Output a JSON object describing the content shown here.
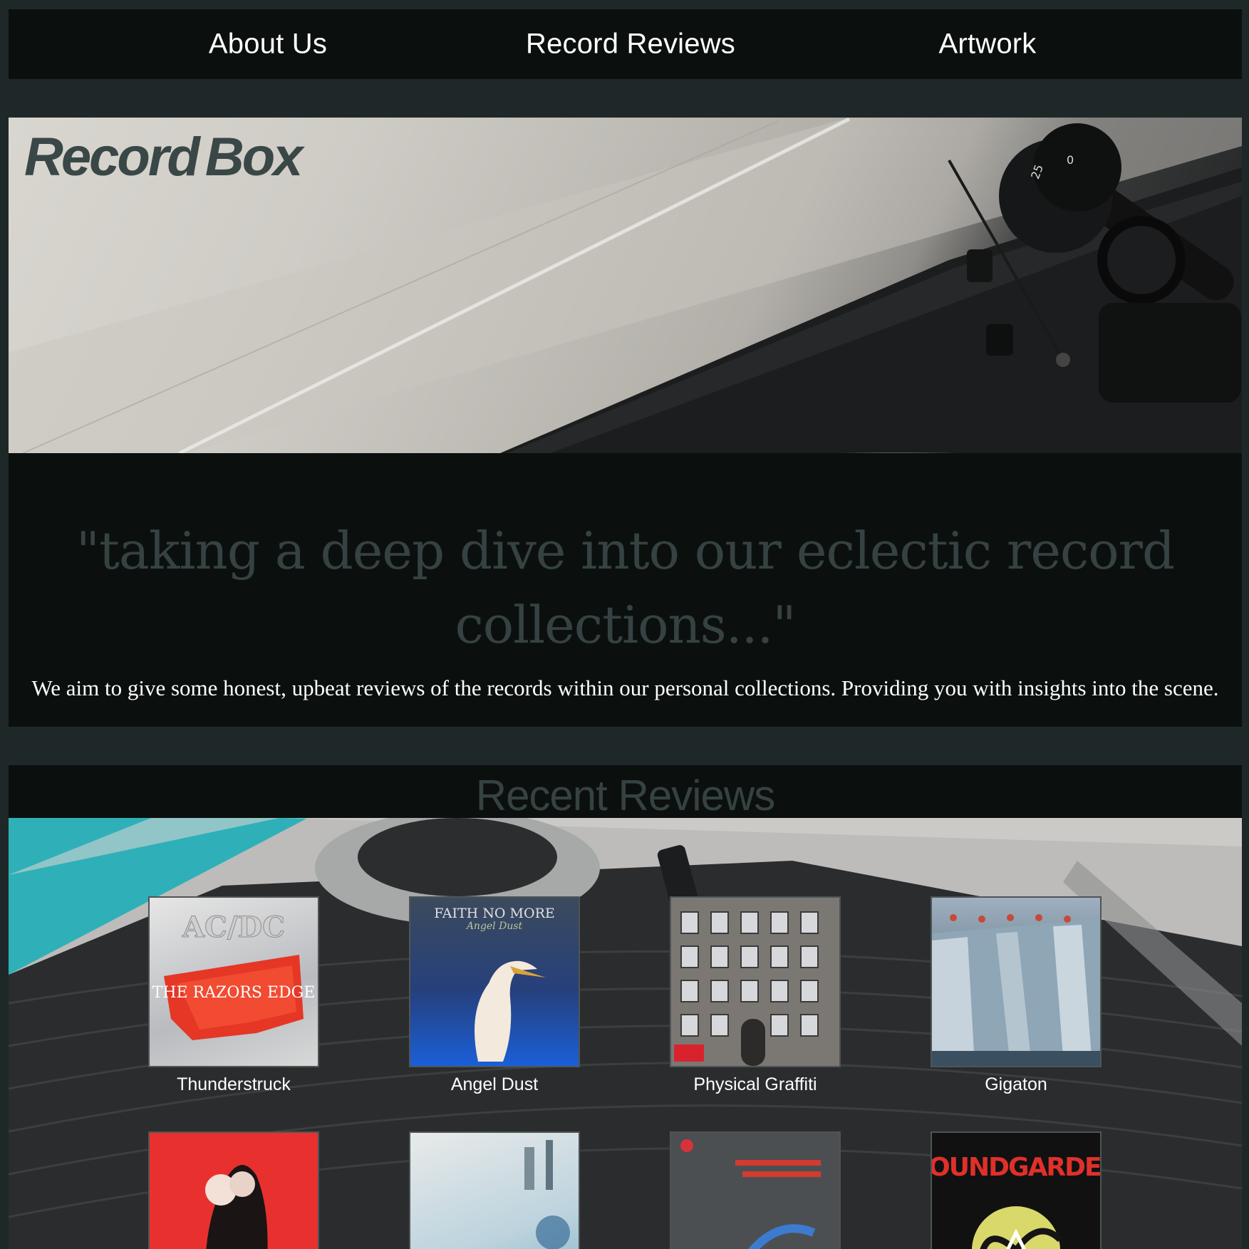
{
  "nav": {
    "about": "About Us",
    "reviews": "Record Reviews",
    "artwork": "Artwork"
  },
  "hero": {
    "logo_part1": "Record",
    "logo_part2": "Box"
  },
  "intro": {
    "tagline": "\"taking a deep dive into our eclectic record collections...\"",
    "mission": "We aim to give some honest, upbeat reviews of the records within our personal collections. Providing you with insights into the scene."
  },
  "recent": {
    "title": "Recent Reviews",
    "albums": [
      {
        "title": "Thunderstruck",
        "cover_text": "AC/DC",
        "cover_sub": "THE RAZORS EDGE"
      },
      {
        "title": "Angel Dust",
        "cover_text": "FAITH NO MORE",
        "cover_sub": "Angel Dust"
      },
      {
        "title": "Physical Graffiti"
      },
      {
        "title": "Gigaton"
      },
      {
        "title": ""
      },
      {
        "title": ""
      },
      {
        "title": ""
      },
      {
        "title": "",
        "cover_text": "SOUNDGARDEN"
      }
    ]
  },
  "colors": {
    "page_bg": "#1f2829",
    "panel_bg": "#0b100f",
    "muted_heading": "#364242",
    "text": "#ffffff"
  }
}
